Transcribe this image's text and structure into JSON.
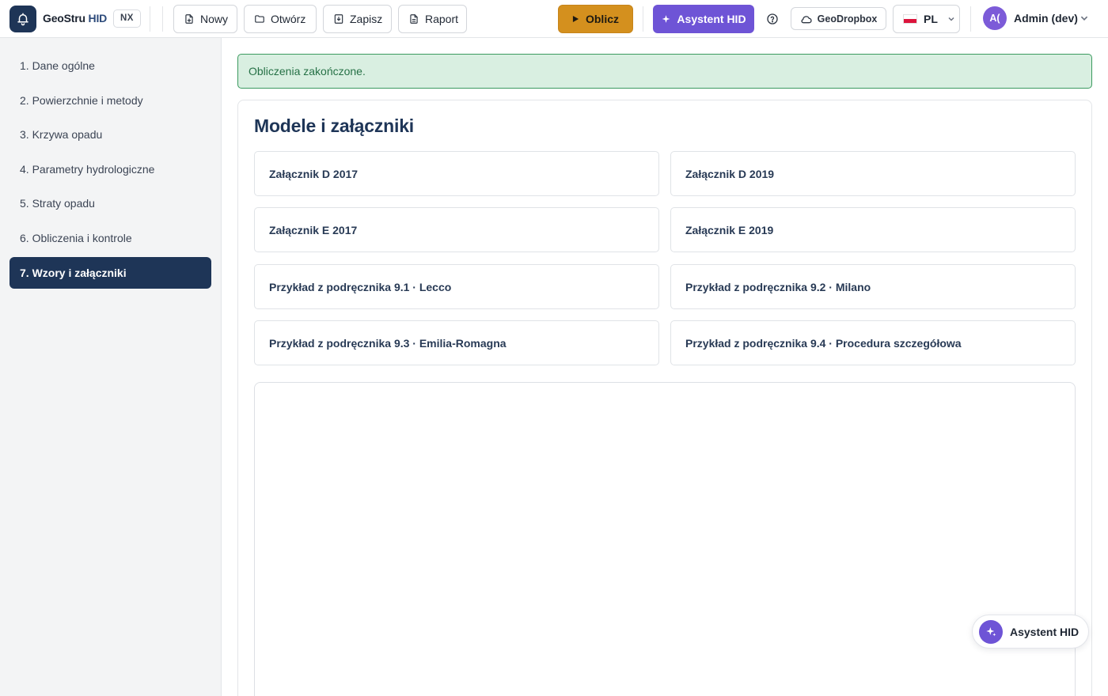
{
  "header": {
    "brand_name": "GeoStru",
    "brand_product": "HID",
    "edition_badge": "NX",
    "toolbar": {
      "new_label": "Nowy",
      "open_label": "Otwórz",
      "save_label": "Zapisz",
      "report_label": "Raport"
    },
    "calculate_label": "Oblicz",
    "assistant_label": "Asystent HID",
    "cloud_label": "GeoDropbox",
    "language_label": "PL",
    "user": {
      "avatar_initials": "A(",
      "name": "Admin (dev)"
    }
  },
  "sidebar": {
    "items": [
      {
        "label": "1. Dane ogólne"
      },
      {
        "label": "2. Powierzchnie i metody"
      },
      {
        "label": "3. Krzywa opadu"
      },
      {
        "label": "4. Parametry hydrologiczne"
      },
      {
        "label": "5. Straty opadu"
      },
      {
        "label": "6. Obliczenia i kontrole"
      },
      {
        "label": "7. Wzory i załączniki",
        "active": true
      }
    ]
  },
  "main": {
    "alert_text": "Obliczenia zakończone.",
    "section_title": "Modele i załączniki",
    "models": [
      {
        "label": "Załącznik D 2017"
      },
      {
        "label": "Załącznik D 2019"
      },
      {
        "label": "Załącznik E 2017"
      },
      {
        "label": "Załącznik E 2019"
      },
      {
        "label": "Przykład z podręcznika 9.1 · Lecco"
      },
      {
        "label": "Przykład z podręcznika 9.2 · Milano"
      },
      {
        "label": "Przykład z podręcznika 9.3 · Emilia-Romagna"
      },
      {
        "label": "Przykład z podręcznika 9.4 · Procedura szczegółowa"
      }
    ]
  },
  "floating_assistant": {
    "label": "Asystent HID"
  },
  "colors": {
    "primary_navy": "#1e3557",
    "calculate_amber": "#d4901e",
    "assistant_purple": "#6e54d6",
    "success_bg": "#d9efe1",
    "success_border": "#3b9a5f"
  },
  "icons": {
    "logo": "bell-outline-icon",
    "new": "file-icon",
    "open": "folder-icon",
    "save": "save-icon",
    "report": "report-icon",
    "calculate": "play-icon",
    "assistant": "sparkles-icon",
    "help": "help-circle-icon",
    "cloud": "cloud-icon",
    "language": "flag-poland-icon",
    "dropdown": "chevron-down-icon"
  }
}
